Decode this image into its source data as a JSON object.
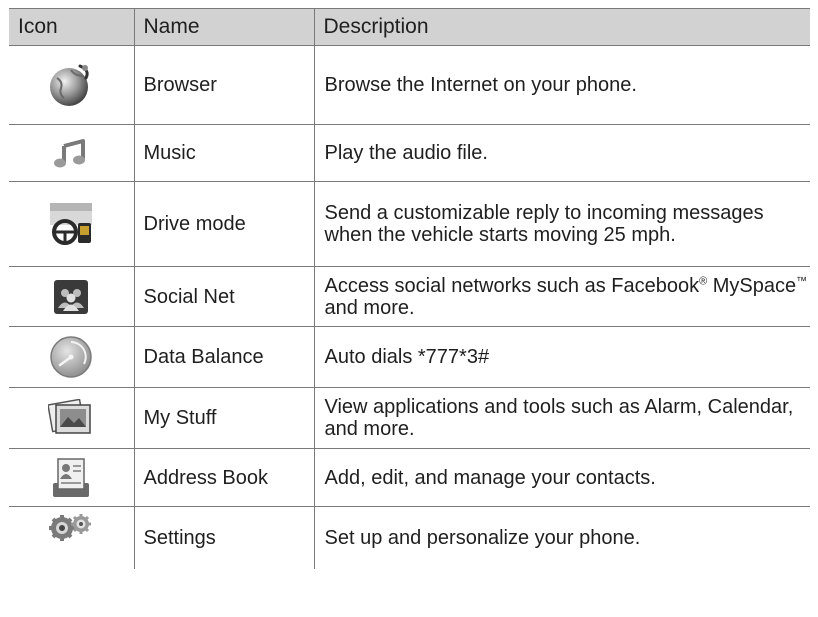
{
  "header": {
    "icon_label": "Icon",
    "name_label": "Name",
    "description_label": "Description"
  },
  "rows": [
    {
      "icon": "browser-globe-icon",
      "name": "Browser",
      "description": "Browse the Internet on your phone."
    },
    {
      "icon": "music-note-icon",
      "name": "Music",
      "description": "Play the audio file."
    },
    {
      "icon": "drive-mode-icon",
      "name": "Drive mode",
      "description": "Send a customizable  reply to incoming messages when the vehicle starts moving 25 mph."
    },
    {
      "icon": "social-net-icon",
      "name": "Social Net",
      "description_pre": "Access social networks such as Facebook",
      "description_reg": "®",
      "description_mid": " MySpace",
      "description_tm": "™",
      "description_post": " and more."
    },
    {
      "icon": "data-balance-gauge-icon",
      "name": "Data Balance",
      "description": "Auto dials *777*3#"
    },
    {
      "icon": "my-stuff-icon",
      "name": "My Stuff",
      "description": "View applications and tools such as Alarm, Calendar, and more."
    },
    {
      "icon": "address-book-icon",
      "name": "Address Book",
      "description": "Add, edit, and manage your contacts."
    },
    {
      "icon": "settings-gears-icon",
      "name": "Settings",
      "description": "Set up and personalize your phone."
    }
  ]
}
